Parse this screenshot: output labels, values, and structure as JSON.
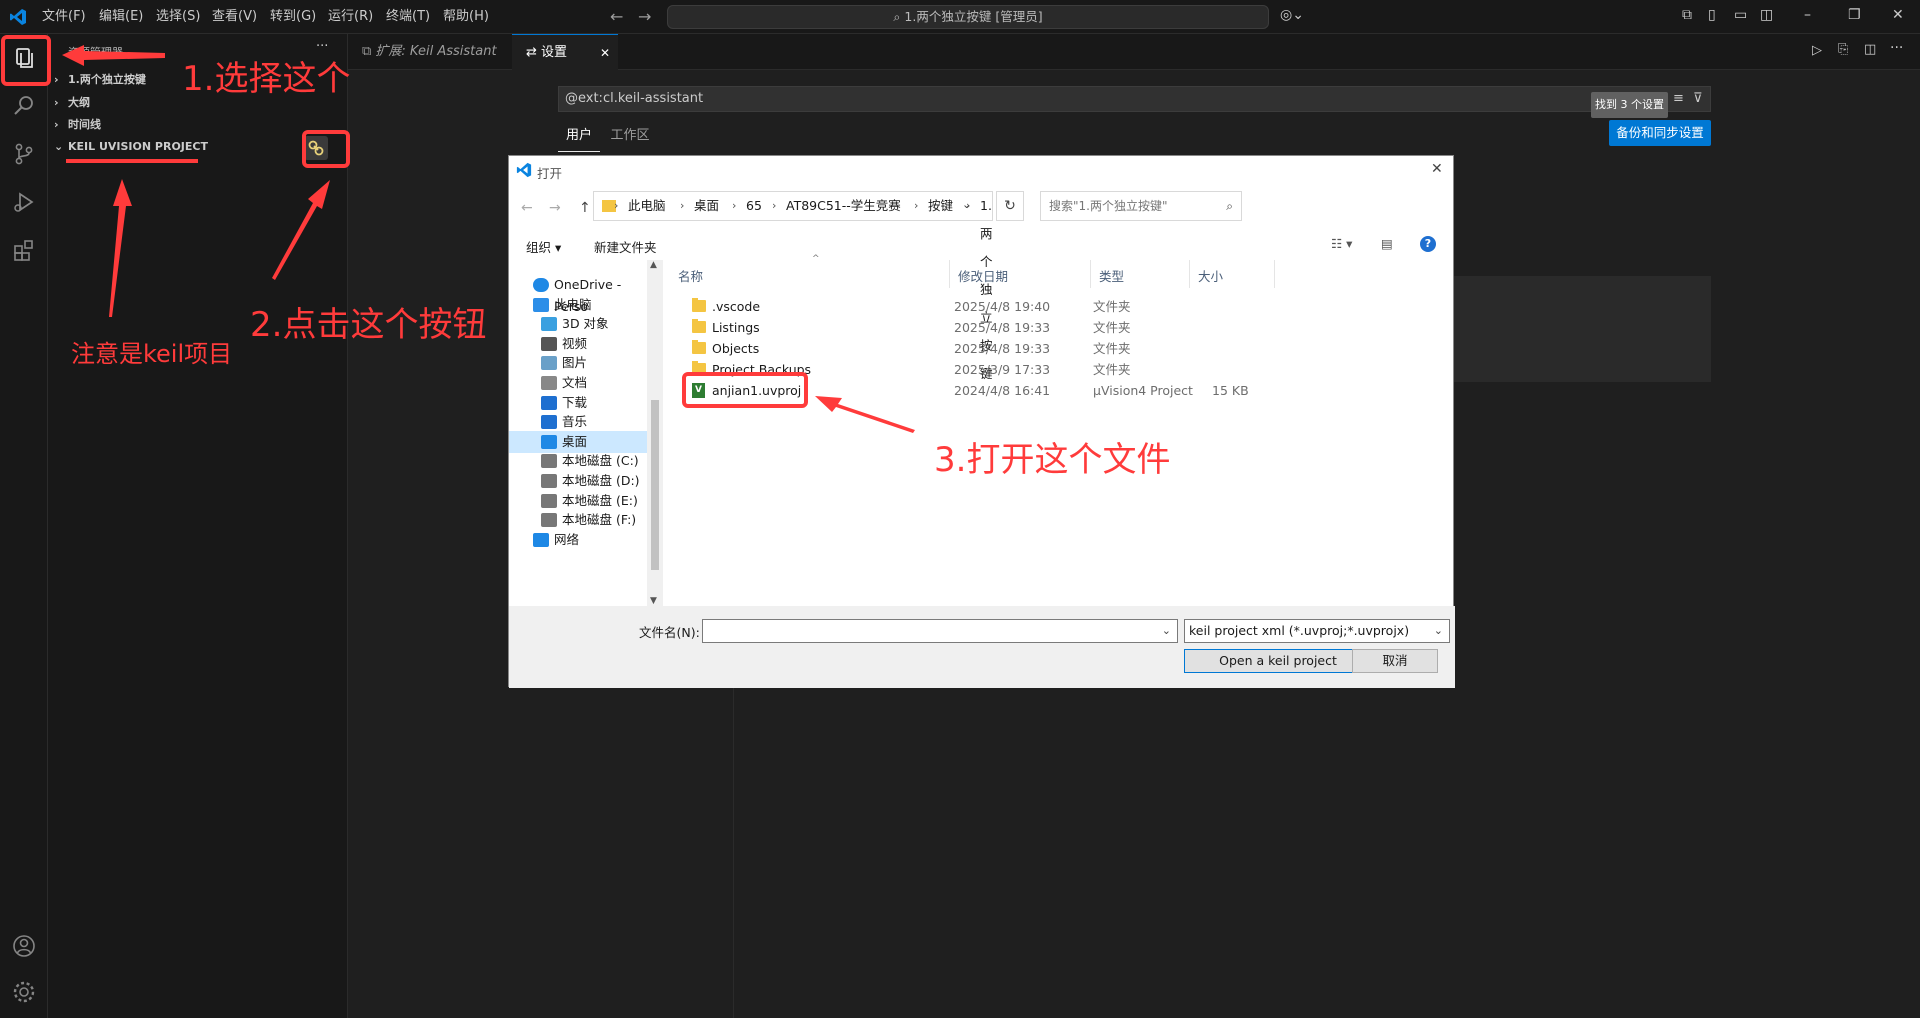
{
  "titlebar": {
    "menus": [
      "文件(F)",
      "编辑(E)",
      "选择(S)",
      "查看(V)",
      "转到(G)",
      "运行(R)",
      "终端(T)",
      "帮助(H)"
    ],
    "search_title": "1.两个独立按键 [管理员]"
  },
  "sidebar": {
    "header": "资源管理器",
    "more": "···",
    "sections": [
      {
        "label": "1.两个独立按键",
        "chev": "›"
      },
      {
        "label": "大纲",
        "chev": "›"
      },
      {
        "label": "时间线",
        "chev": "›"
      },
      {
        "label": "KEIL UVISION PROJECT",
        "chev": "⌄"
      }
    ]
  },
  "tabs": [
    {
      "label": "扩展: Keil Assistant",
      "active": false
    },
    {
      "label": "设置",
      "active": true
    }
  ],
  "settings": {
    "search_value": "@ext:cl.keil-assistant",
    "found_badge": "找到 3 个设置",
    "scope_tabs": [
      "用户",
      "工作区"
    ],
    "sync_button": "备份和同步设置"
  },
  "dialog": {
    "title": "打开",
    "breadcrumb": [
      "此电脑",
      "桌面",
      "65",
      "AT89C51--学生竞赛",
      "按键",
      "1.两个独立按键"
    ],
    "search_placeholder": "搜索\"1.两个独立按键\"",
    "organize": "组织 ▾",
    "new_folder": "新建文件夹",
    "tree": [
      {
        "label": "OneDrive - Perso",
        "icon": "cloud-icon",
        "indent": 0
      },
      {
        "label": "此电脑",
        "icon": "computer-icon",
        "indent": 0
      },
      {
        "label": "3D 对象",
        "icon": "cube-icon",
        "indent": 1
      },
      {
        "label": "视频",
        "icon": "video-icon",
        "indent": 1
      },
      {
        "label": "图片",
        "icon": "picture-icon",
        "indent": 1
      },
      {
        "label": "文档",
        "icon": "document-icon",
        "indent": 1
      },
      {
        "label": "下载",
        "icon": "download-icon",
        "indent": 1
      },
      {
        "label": "音乐",
        "icon": "music-icon",
        "indent": 1
      },
      {
        "label": "桌面",
        "icon": "desktop-icon",
        "indent": 1
      },
      {
        "label": "本地磁盘 (C:)",
        "icon": "drive-icon",
        "indent": 1
      },
      {
        "label": "本地磁盘 (D:)",
        "icon": "drive-icon",
        "indent": 1
      },
      {
        "label": "本地磁盘 (E:)",
        "icon": "drive-icon",
        "indent": 1
      },
      {
        "label": "本地磁盘 (F:)",
        "icon": "drive-icon",
        "indent": 1
      },
      {
        "label": "网络",
        "icon": "network-icon",
        "indent": 0
      }
    ],
    "columns": [
      "名称",
      "修改日期",
      "类型",
      "大小"
    ],
    "files": [
      {
        "name": ".vscode",
        "date": "2025/4/8 19:40",
        "type": "文件夹",
        "size": "",
        "kind": "folder"
      },
      {
        "name": "Listings",
        "date": "2025/4/8 19:33",
        "type": "文件夹",
        "size": "",
        "kind": "folder"
      },
      {
        "name": "Objects",
        "date": "2025/4/8 19:33",
        "type": "文件夹",
        "size": "",
        "kind": "folder"
      },
      {
        "name": "Project Backups",
        "date": "2025/3/9 17:33",
        "type": "文件夹",
        "size": "",
        "kind": "folder"
      },
      {
        "name": "anjian1.uvproj",
        "date": "2024/4/8 16:41",
        "type": "µVision4 Project",
        "size": "15 KB",
        "kind": "uvproj"
      }
    ],
    "filename_label": "文件名(N):",
    "filename_value": "",
    "filter": "keil project xml (*.uvproj;*.uvprojx)",
    "open_button": "Open a keil project",
    "cancel_button": "取消"
  },
  "annotations": {
    "step1": "1.选择这个",
    "step2": "2.点击这个按钮",
    "note": "注意是keil项目",
    "step3": "3.打开这个文件"
  },
  "colors": {
    "accent": "#0078d4",
    "annotation": "#ff3b3b",
    "selected": "#cce8ff"
  }
}
